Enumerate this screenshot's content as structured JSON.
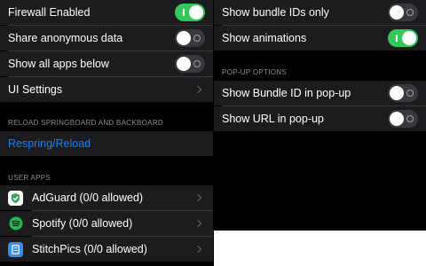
{
  "left": {
    "rows": [
      {
        "label": "Firewall Enabled",
        "toggle": "on"
      },
      {
        "label": "Share anonymous data",
        "toggle": "off"
      },
      {
        "label": "Show all apps below",
        "toggle": "off"
      },
      {
        "label": "UI Settings",
        "chevron": true
      }
    ],
    "reload_header": "RELOAD SPRINGBOARD AND BACKBOARD",
    "respring_label": "Respring/Reload",
    "user_apps_header": "USER APPS",
    "apps": [
      {
        "label": "AdGuard (0/0 allowed)",
        "icon": "adguard-shield-icon"
      },
      {
        "label": "Spotify (0/0 allowed)",
        "icon": "spotify-icon"
      },
      {
        "label": "StitchPics (0/0 allowed)",
        "icon": "stitchpics-icon"
      }
    ]
  },
  "right": {
    "rows": [
      {
        "label": "Show bundle IDs only",
        "toggle": "off"
      },
      {
        "label": "Show animations",
        "toggle": "on"
      }
    ],
    "popup_header": "POP-UP OPTIONS",
    "popup_rows": [
      {
        "label": "Show Bundle ID in pop-up",
        "toggle": "off"
      },
      {
        "label": "Show URL in pop-up",
        "toggle": "off"
      }
    ]
  },
  "colors": {
    "cell_bg": "#1c1c1e",
    "toggle_on": "#34c759",
    "toggle_off": "#39393d",
    "link": "#0a84ff",
    "header_text": "#8e8e93"
  }
}
